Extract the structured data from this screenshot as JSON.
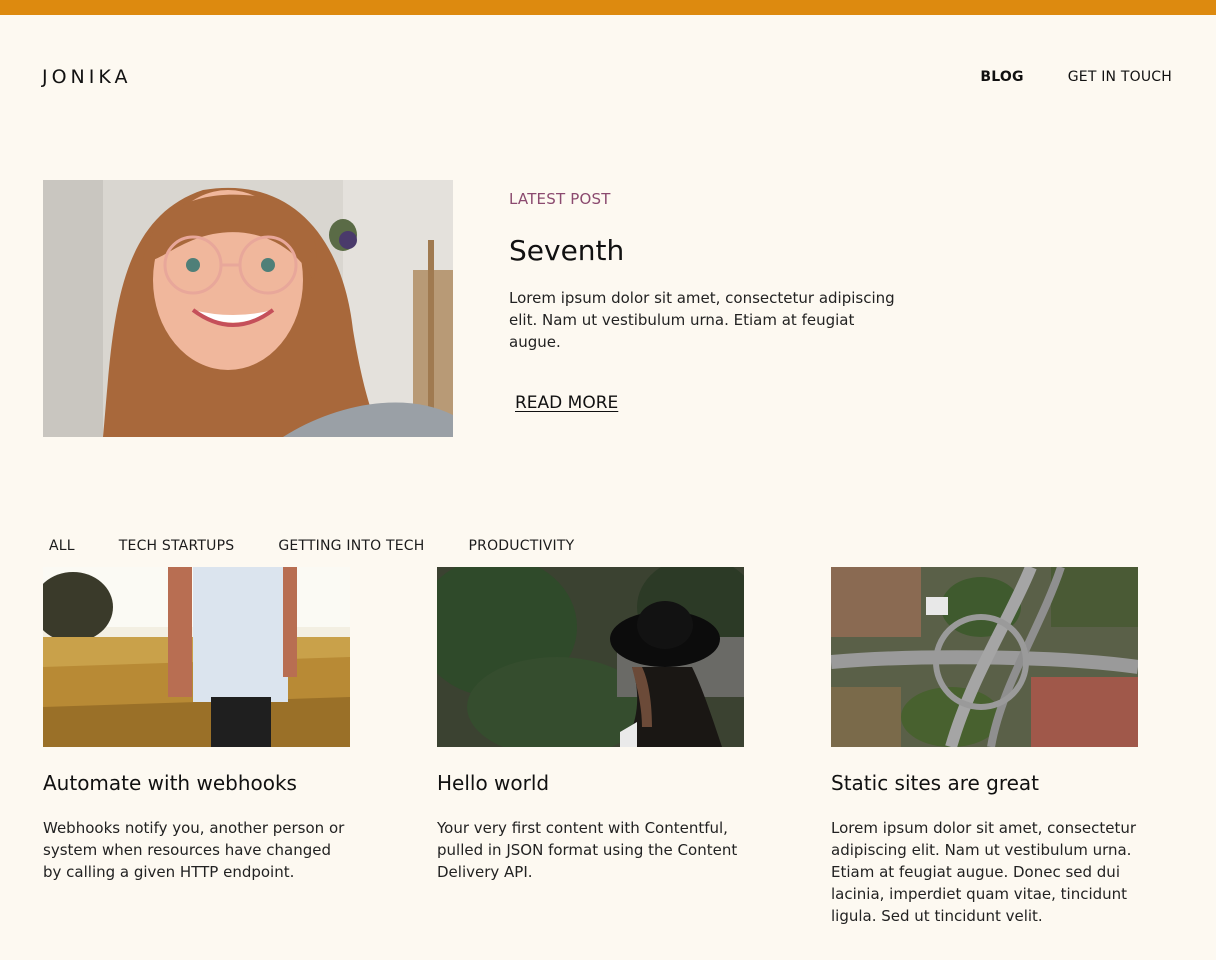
{
  "brand": {
    "logo": "JONIKA"
  },
  "nav": {
    "blog": "BLOG",
    "contact": "GET IN TOUCH"
  },
  "hero": {
    "kicker": "LATEST POST",
    "title": "Seventh",
    "excerpt": "Lorem ipsum dolor sit amet, consectetur adipiscing elit. Nam ut vestibulum urna. Etiam at feugiat augue.",
    "read_more": "READ MORE"
  },
  "filters": [
    "ALL",
    "TECH STARTUPS",
    "GETTING INTO TECH",
    "PRODUCTIVITY"
  ],
  "posts": [
    {
      "title": "Automate with webhooks",
      "excerpt": "Webhooks notify you, another person or system when resources have changed by calling a given HTTP endpoint."
    },
    {
      "title": "Hello world",
      "excerpt": "Your very first content with Contentful, pulled in JSON format using the Content Delivery API."
    },
    {
      "title": "Static sites are great",
      "excerpt": "Lorem ipsum dolor sit amet, consectetur adipiscing elit. Nam ut vestibulum urna. Etiam at feugiat augue. Donec sed dui lacinia, imperdiet quam vitae, tincidunt ligula. Sed ut tincidunt velit."
    }
  ],
  "colors": {
    "accent_bar": "#dd8a0f",
    "background": "#fdf9f1",
    "kicker": "#8b4a6f"
  }
}
